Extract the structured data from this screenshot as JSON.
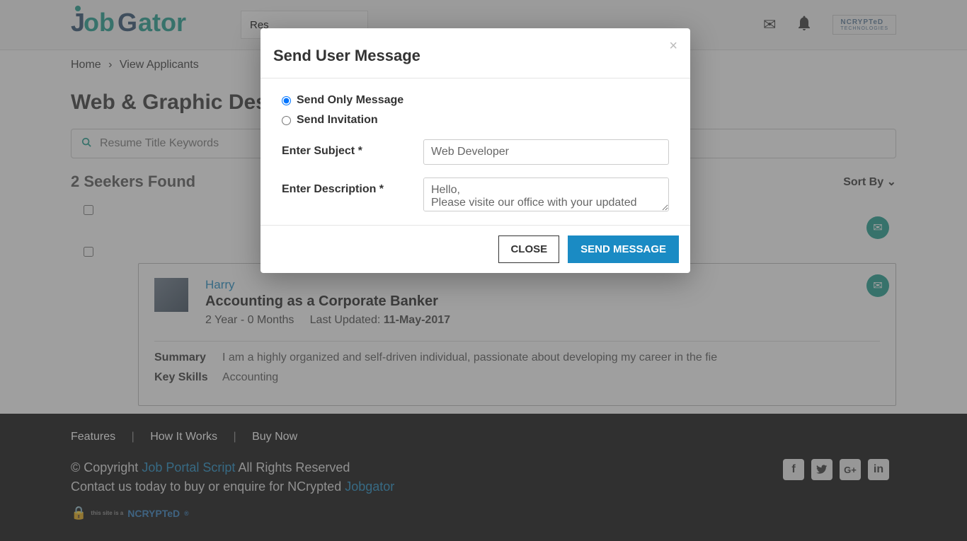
{
  "header": {
    "logo_text": "JobGator",
    "search_placeholder": "Res",
    "ncrypted": "NCRYPTeD",
    "ncrypted_sub": "TECHNOLOGIES"
  },
  "breadcrumb": {
    "home": "Home",
    "current": "View Applicants"
  },
  "page": {
    "title": "Web & Graphic Designer",
    "search_placeholder": "Resume Title Keywords",
    "results_count": "2 Seekers Found",
    "sort_by": "Sort By"
  },
  "applicant": {
    "name": "Harry",
    "title": "Accounting as a Corporate Banker",
    "experience": "2 Year - 0 Months",
    "updated_label": "Last Updated: ",
    "updated_date": "11-May-2017",
    "summary_label": "Summary",
    "summary_text": "I am a highly organized and self-driven individual, passionate about developing my career in the fie",
    "skills_label": "Key Skills",
    "skills_text": "Accounting"
  },
  "footer": {
    "features": "Features",
    "how": "How It Works",
    "buy": "Buy Now",
    "copyright_pre": "© Copyright ",
    "copyright_link": "Job Portal Script",
    "copyright_post": " All Rights Reserved",
    "contact_pre": "Contact us today to buy or enquire for NCrypted ",
    "contact_link": "Jobgator",
    "ncrypted_pre": "this site is a",
    "ncrypted": "NCRYPTeD"
  },
  "modal": {
    "title": "Send User Message",
    "opt_message": "Send Only Message",
    "opt_invitation": "Send Invitation",
    "subject_label": "Enter Subject *",
    "subject_value": "Web Developer",
    "description_label": "Enter Description *",
    "description_value": "Hello,\nPlease visite our office with your updated resume",
    "btn_close": "CLOSE",
    "btn_send": "SEND MESSAGE"
  }
}
